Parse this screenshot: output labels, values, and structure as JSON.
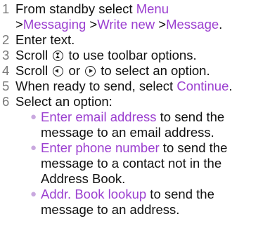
{
  "steps": [
    {
      "num": "1",
      "text_a": "From standby select ",
      "link_1": "Menu",
      "line2_sep_1": ">",
      "link_2": "Messaging",
      "line2_sep_2": " >",
      "link_3": "Write new",
      "line2_sep_3": " >",
      "link_4": "Message",
      "end": "."
    },
    {
      "num": "2",
      "text": "Enter text."
    },
    {
      "num": "3",
      "text_a": "Scroll ",
      "text_b": " to use toolbar options."
    },
    {
      "num": "4",
      "text_a": "Scroll ",
      "text_b": " or ",
      "text_c": " to select an option."
    },
    {
      "num": "5",
      "text_a": "When ready to send, select ",
      "link": "Continue",
      "end": "."
    },
    {
      "num": "6",
      "text": "Select an option:"
    }
  ],
  "options": [
    {
      "link": "Enter email address",
      "text": " to send the message to an email address."
    },
    {
      "link": "Enter phone number",
      "text": " to send the message to a contact not in the Address Book."
    },
    {
      "link": "Addr. Book lookup",
      "text": " to send the message to an address."
    }
  ],
  "icons": {
    "scroll_updown": "nav-updown-icon",
    "scroll_left": "nav-left-icon",
    "scroll_right": "nav-right-icon"
  },
  "colors": {
    "link": "#9b3fd0",
    "number": "#7a7a7a",
    "bullet": "#c9a8df"
  }
}
